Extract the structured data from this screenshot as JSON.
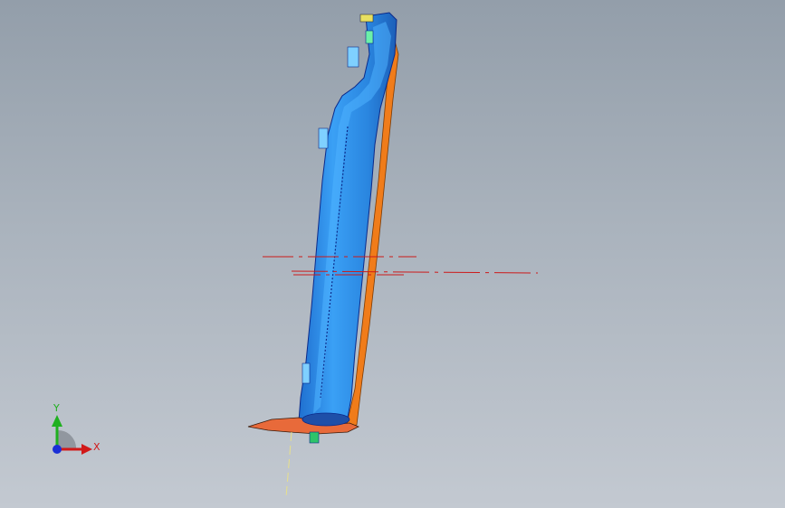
{
  "viewport": {
    "background_top": "#939eaa",
    "background_bottom": "#c3c9d1"
  },
  "model": {
    "name": "part-body",
    "main_color": "#2a86e0",
    "highlight_color": "#4fb2ff",
    "edge_color": "#0b2a8a",
    "side_color": "#f07c1a"
  },
  "reference_lines": {
    "color": "#cc1a1a",
    "axis_color": "#e8e08a"
  },
  "triad": {
    "x_label": "X",
    "y_label": "Y",
    "x_color": "#d11919",
    "y_color": "#1fb01f",
    "z_color": "#1a2fd6"
  }
}
